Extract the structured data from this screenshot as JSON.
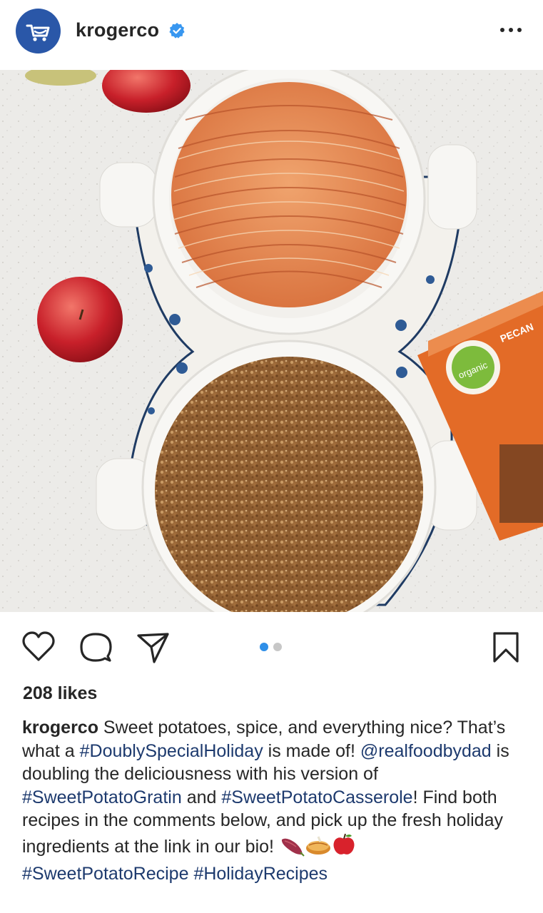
{
  "header": {
    "username": "krogerco",
    "avatar_icon": "kroger-cart-logo-icon",
    "verified_icon": "verified-badge-icon",
    "more_icon": "more-options-icon",
    "brand_color": "#2a57a8",
    "verified_color": "#3897f0"
  },
  "post": {
    "image_alt": "Apple dessert and sweet potato casserole in white baking dishes",
    "carousel": {
      "count": 2,
      "active_index": 0,
      "active_color": "#2f8fe8"
    },
    "actions": {
      "like_icon": "heart-icon",
      "comment_icon": "comment-icon",
      "share_icon": "share-icon",
      "save_icon": "bookmark-icon"
    },
    "likes_text": "208 likes",
    "caption": {
      "user": "krogerco",
      "p1": " Sweet potatoes, spice, and everything nice? That’s what a ",
      "tag1": "#DoublySpecialHoliday",
      "p2": " is made of! ",
      "mention": "@realfoodbydad",
      "p3": " is doubling the deliciousness with his version of ",
      "tag2": "#SweetPotatoGratin",
      "p4": " and ",
      "tag3": "#SweetPotatoCasserole",
      "p5": "! Find both recipes in the comments below, and pick up the fresh holiday ingredients at the link in our bio! ",
      "emojis": [
        "sweet-potato-emoji",
        "pie-emoji",
        "apple-emoji"
      ],
      "tag4": "#SweetPotatoRecipe",
      "tag5": "#HolidayRecipes"
    },
    "link_color": "#1d3a6e"
  }
}
